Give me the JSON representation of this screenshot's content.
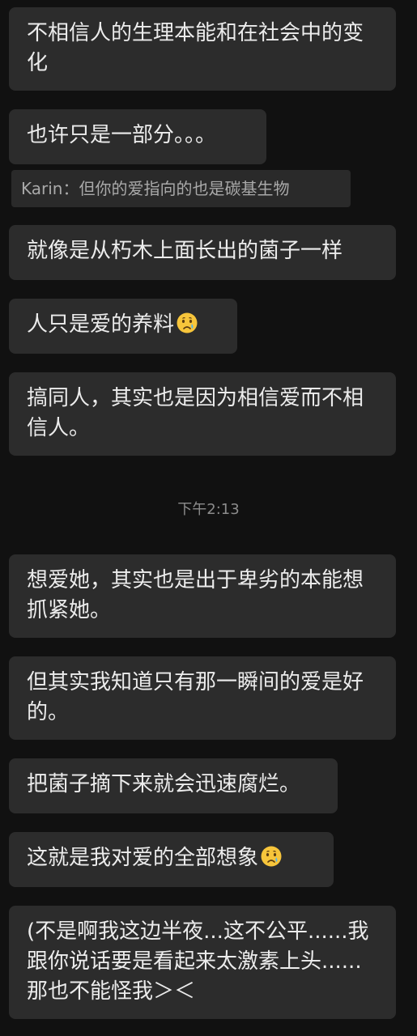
{
  "messages": [
    {
      "text": "不相信人的生理本能和在社会中的变化"
    },
    {
      "text": "也许只是一部分。。。"
    },
    {
      "text": "就像是从朽木上面长出的菌子一样"
    },
    {
      "text": "人只是爱的养料",
      "emoji": "crying-face"
    },
    {
      "text": "搞同人，其实也是因为相信爱而不相信人。"
    },
    {
      "text": "想爱她，其实也是出于卑劣的本能想抓紧她。"
    },
    {
      "text": "但其实我知道只有那一瞬间的爱是好的。"
    },
    {
      "text": "把菌子摘下来就会迅速腐烂。"
    },
    {
      "text": "这就是我对爱的全部想象",
      "emoji": "crying-face"
    },
    {
      "text": "(不是啊我这边半夜...这不公平......我跟你说话要是看起来太激素上头......那也不能怪我＞＜"
    }
  ],
  "quote": {
    "text": "Karin：但你的爱指向的也是碳基生物"
  },
  "timestamp": "下午2:13",
  "colors": {
    "background": "#111111",
    "bubble": "#2c2c2c",
    "text": "#ececec",
    "quote_text": "#a9a9a9",
    "timestamp": "#8c8c8c"
  }
}
